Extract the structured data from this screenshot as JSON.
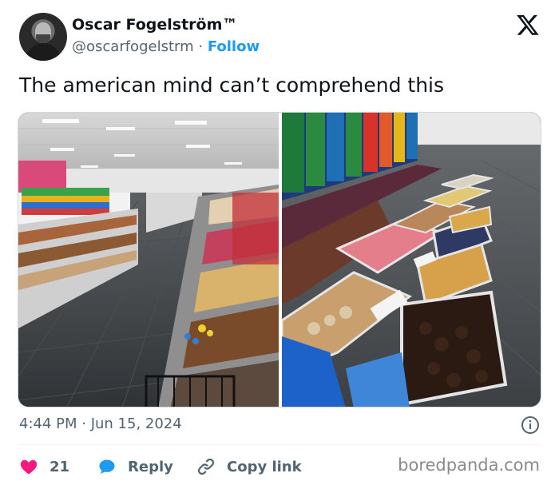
{
  "author": {
    "name": "Oscar Fogelström™",
    "handle": "@oscarfogelstrm",
    "separator": "·",
    "follow_label": "Follow"
  },
  "tweet": {
    "text": "The american mind can’t comprehend this",
    "timestamp": "4:44 PM · Jun 15, 2024"
  },
  "actions": {
    "like_count": "21",
    "reply_label": "Reply",
    "copy_link_label": "Copy link"
  },
  "watermark": "boredpanda.com",
  "colors": {
    "accent": "#1d9bf0",
    "heart": "#f91880",
    "text_primary": "#0f1419",
    "text_secondary": "#536471"
  },
  "icons": {
    "logo": "x-logo-icon",
    "info": "info-icon",
    "like": "heart-icon",
    "reply": "speech-bubble-icon",
    "copy": "link-icon"
  }
}
